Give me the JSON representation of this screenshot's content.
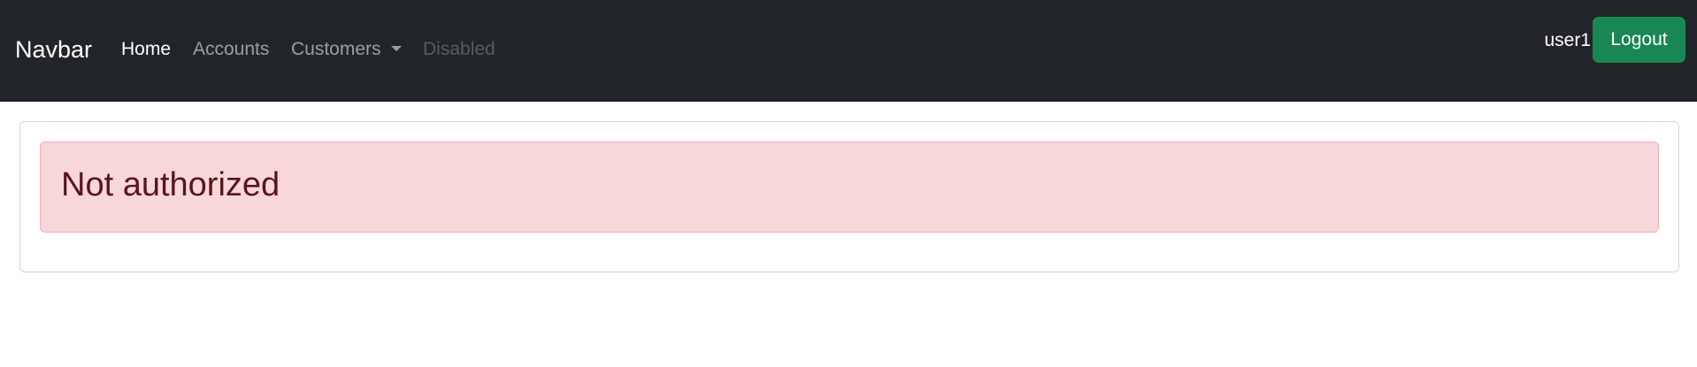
{
  "navbar": {
    "brand": "Navbar",
    "links": [
      {
        "label": "Home"
      },
      {
        "label": "Accounts"
      },
      {
        "label": "Customers"
      },
      {
        "label": "Disabled"
      }
    ],
    "username": "user1",
    "logout_label": "Logout",
    "background_color": "#212529"
  },
  "main": {
    "alert_text": "Not authorized",
    "alert_background": "#f8d7da",
    "alert_text_color": "#58151c"
  },
  "colors": {
    "logout_button": "#198754"
  }
}
